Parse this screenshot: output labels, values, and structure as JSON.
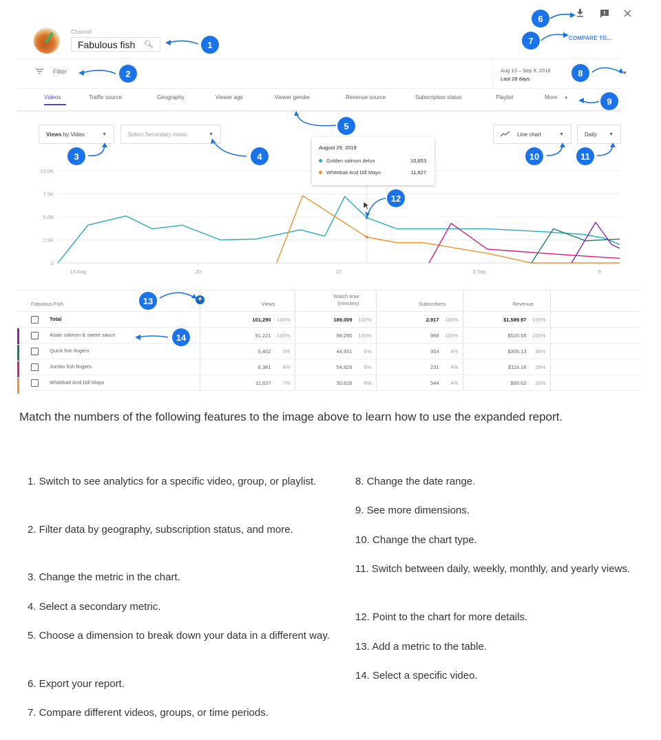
{
  "header": {
    "channel_label": "Channel",
    "channel_name": "Fabulous fish",
    "icons": [
      "search-icon",
      "download-icon",
      "feedback-icon",
      "close-icon"
    ],
    "compare_label": "COMPARE TO...",
    "filter_label": "Filter",
    "date_range": "Aug 13 – Sep 9, 2018",
    "date_period": "Last 28 days"
  },
  "tabs": [
    {
      "label": "Videos",
      "active": true
    },
    {
      "label": "Traffic source"
    },
    {
      "label": "Geography"
    },
    {
      "label": "Viewer age"
    },
    {
      "label": "Viewer gender"
    },
    {
      "label": "Revenue source"
    },
    {
      "label": "Subscription status"
    },
    {
      "label": "Playlist"
    },
    {
      "label": "More"
    }
  ],
  "controls": {
    "metric_bold": "Views",
    "metric_rest": " by Video",
    "secondary_placeholder": "Select Secondary metric",
    "chart_type": "Line chart",
    "granularity": "Daily"
  },
  "tooltip": {
    "date": "August 29, 2019",
    "rows": [
      {
        "name": "Golden salmon delux",
        "value": "10,653",
        "color": "#26a9c2"
      },
      {
        "name": "Whitebait And Dill Mayo",
        "value": "11,627",
        "color": "#f0922b"
      }
    ]
  },
  "chart_data": {
    "type": "line",
    "title": "",
    "xlabel": "",
    "ylabel": "",
    "x_ticks": [
      {
        "label": "13 Aug",
        "day": 1
      },
      {
        "label": "20",
        "day": 7
      },
      {
        "label": "27",
        "day": 14
      },
      {
        "label": "3 Sep",
        "day": 21
      },
      {
        "label": "9",
        "day": 27
      }
    ],
    "y_ticks": [
      "0",
      "2.5K",
      "5.0K",
      "7.5K",
      "10.0K"
    ],
    "ylim": [
      0,
      10000
    ],
    "xlim": [
      0,
      28
    ],
    "grid": true,
    "hover_day": 15.4,
    "series": [
      {
        "name": "Golden salmon delux",
        "color": "#26a9c2",
        "points": [
          [
            0,
            0
          ],
          [
            1.5,
            4100
          ],
          [
            3.4,
            5100
          ],
          [
            4.7,
            3700
          ],
          [
            6.2,
            4100
          ],
          [
            8.1,
            2500
          ],
          [
            9.9,
            2600
          ],
          [
            12.1,
            3600
          ],
          [
            13.3,
            2900
          ],
          [
            14.3,
            7200
          ],
          [
            15.4,
            4900
          ],
          [
            16.9,
            3700
          ],
          [
            21.4,
            3700
          ],
          [
            24.1,
            3400
          ],
          [
            26.2,
            3100
          ],
          [
            27.2,
            2700
          ],
          [
            28,
            2000
          ]
        ]
      },
      {
        "name": "Whitebait And Dill Mayo",
        "color": "#f0922b",
        "points": [
          [
            10.9,
            0
          ],
          [
            12.2,
            7300
          ],
          [
            15.4,
            2800
          ],
          [
            16.9,
            2200
          ],
          [
            18.2,
            2200
          ],
          [
            21.5,
            1000
          ],
          [
            23.6,
            0
          ],
          [
            28,
            0
          ]
        ]
      },
      {
        "name": "Jumbo fish fingers",
        "color": "#d81b7a",
        "points": [
          [
            18.5,
            0
          ],
          [
            19.6,
            4300
          ],
          [
            21.4,
            1500
          ],
          [
            24.5,
            1000
          ],
          [
            28,
            500
          ]
        ]
      },
      {
        "name": "Quick fish fingers",
        "color": "#1e7a6a",
        "points": [
          [
            23.6,
            0
          ],
          [
            24.7,
            3700
          ],
          [
            26.3,
            2400
          ],
          [
            28,
            2600
          ]
        ]
      },
      {
        "name": "Asian salmon & sweet sauce",
        "color": "#8e24aa",
        "points": [
          [
            25.6,
            0
          ],
          [
            26.8,
            4400
          ],
          [
            27.6,
            2000
          ],
          [
            28,
            1600
          ]
        ]
      }
    ]
  },
  "table": {
    "dimension_header": "Fabulous Fish",
    "columns": [
      "Views",
      "Watch time (minutes)",
      "Subscribers",
      "Revenue"
    ],
    "watch_line1": "Watch time",
    "watch_line2": "(minutes)",
    "rows": [
      {
        "name": "Total",
        "color": "",
        "views": "101,290",
        "views_pct": "100%",
        "watch": "189,009",
        "watch_pct": "100%",
        "subs": "2,917",
        "subs_pct": "100%",
        "rev": "$1,589.97",
        "rev_pct": "100%"
      },
      {
        "name": "Asian salmon & sweet sauce",
        "color": "#8e24aa",
        "views": "91,221",
        "views_pct": "100%",
        "watch": "98,290",
        "watch_pct": "100%",
        "subs": "988",
        "subs_pct": "100%",
        "rev": "$520.55",
        "rev_pct": "100%"
      },
      {
        "name": "Quick fish fingers",
        "color": "#1e7a6a",
        "views": "5,402",
        "views_pct": "3%",
        "watch": "44,951",
        "watch_pct": "6%",
        "subs": "354",
        "subs_pct": "8%",
        "rev": "$305.13",
        "rev_pct": "38%"
      },
      {
        "name": "Jumbo fish fingers",
        "color": "#d81b7a",
        "views": "6,381",
        "views_pct": "4%",
        "watch": "54,829",
        "watch_pct": "6%",
        "subs": "231",
        "subs_pct": "4%",
        "rev": "$116.18",
        "rev_pct": "29%"
      },
      {
        "name": "Whitebait And Dill Mayo",
        "color": "#f0922b",
        "views": "11,627",
        "views_pct": "7%",
        "watch": "30,626",
        "watch_pct": "8%",
        "subs": "544",
        "subs_pct": "4%",
        "rev": "$89.62",
        "rev_pct": "26%"
      }
    ]
  },
  "callouts": [
    "1",
    "2",
    "3",
    "4",
    "5",
    "6",
    "7",
    "8",
    "9",
    "10",
    "11",
    "12",
    "13",
    "14"
  ],
  "instructions": {
    "intro": "Match the numbers of the following features to the image above to learn how to use the expanded report.",
    "left": [
      "1. Switch to see analytics for a specific video, group, or playlist.",
      "2. Filter data by geography, subscription status, and more.",
      "3. Change the metric in the chart.",
      "4. Select a secondary metric.",
      "5. Choose a dimension to break down your data in a different way.",
      "6. Export your report.",
      "7. Compare different videos, groups, or time periods."
    ],
    "right": [
      "8. Change the date range.",
      "9. See more dimensions.",
      "10. Change the chart type.",
      "11. Switch between daily, weekly, monthly, and yearly views.",
      "12. Point to the chart for more details.",
      "13. Add a metric to the table.",
      "14. Select a specific video."
    ]
  }
}
